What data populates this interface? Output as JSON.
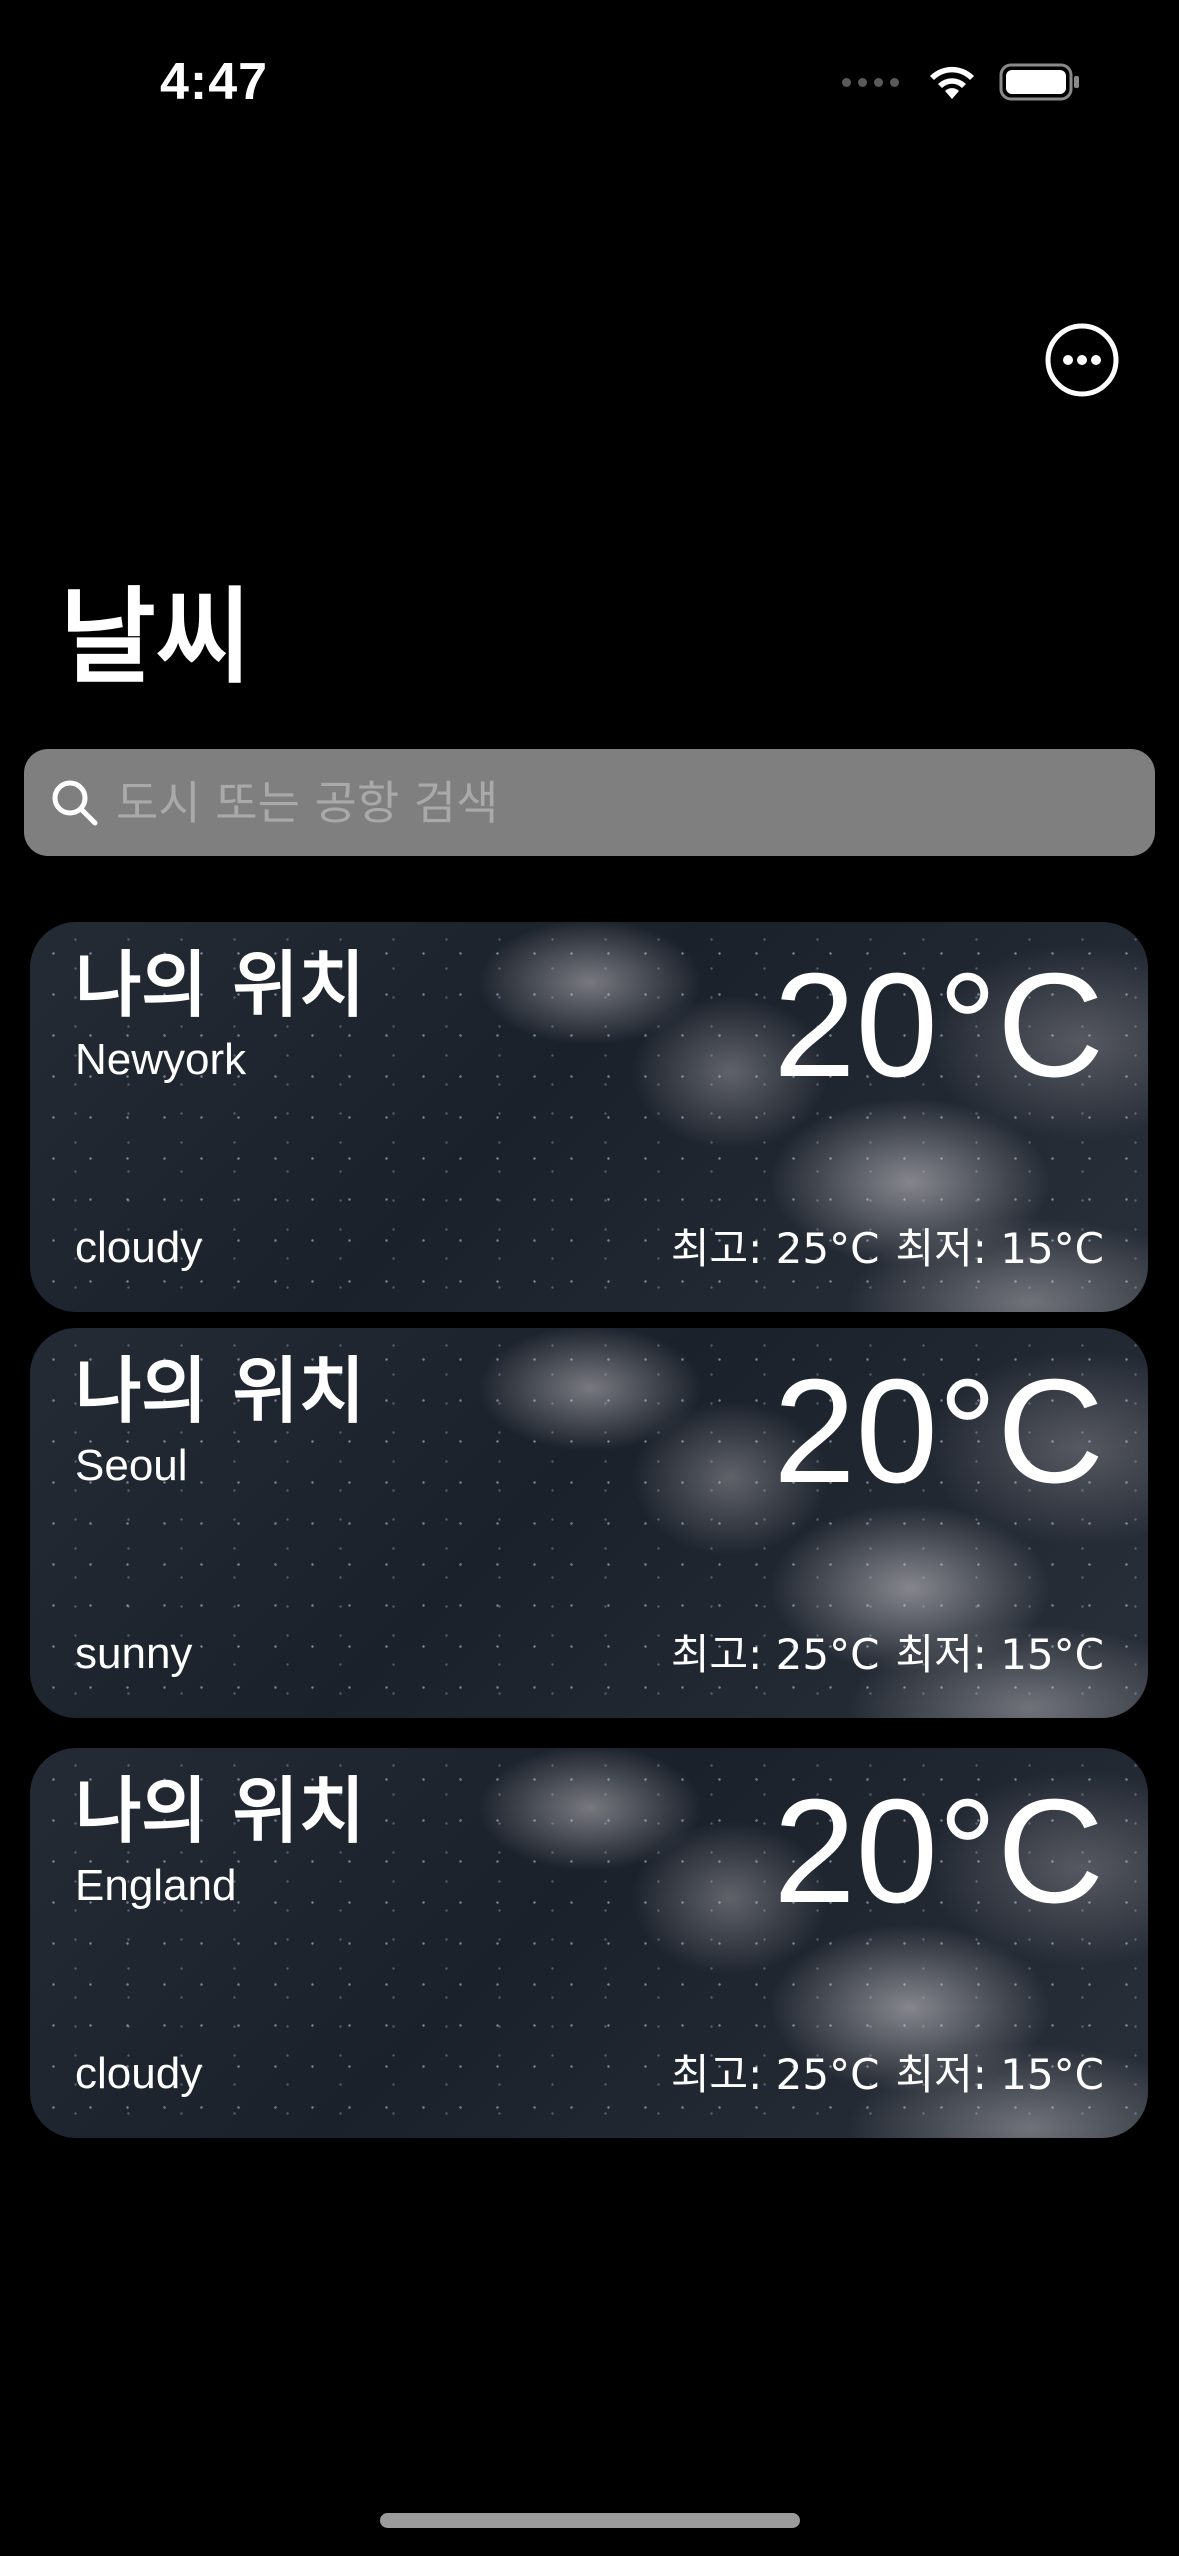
{
  "status_bar": {
    "time": "4:47"
  },
  "header": {
    "title": "날씨",
    "more_icon": "ellipsis-circle-icon"
  },
  "search": {
    "placeholder": "도시 또는 공항 검색",
    "value": "",
    "icon": "search-icon"
  },
  "cards": [
    {
      "location": "나의 위치",
      "city": "Newyork",
      "temperature": "20°C",
      "condition": "cloudy",
      "high": "최고: 25°C",
      "low": "최저: 15°C"
    },
    {
      "location": "나의 위치",
      "city": "Seoul",
      "temperature": "20°C",
      "condition": "sunny",
      "high": "최고: 25°C",
      "low": "최저: 15°C"
    },
    {
      "location": "나의 위치",
      "city": "England",
      "temperature": "20°C",
      "condition": "cloudy",
      "high": "최고: 25°C",
      "low": "최저: 15°C"
    }
  ],
  "colors": {
    "background": "#000000",
    "search_bar": "#7f7f7f",
    "text": "#ffffff"
  }
}
